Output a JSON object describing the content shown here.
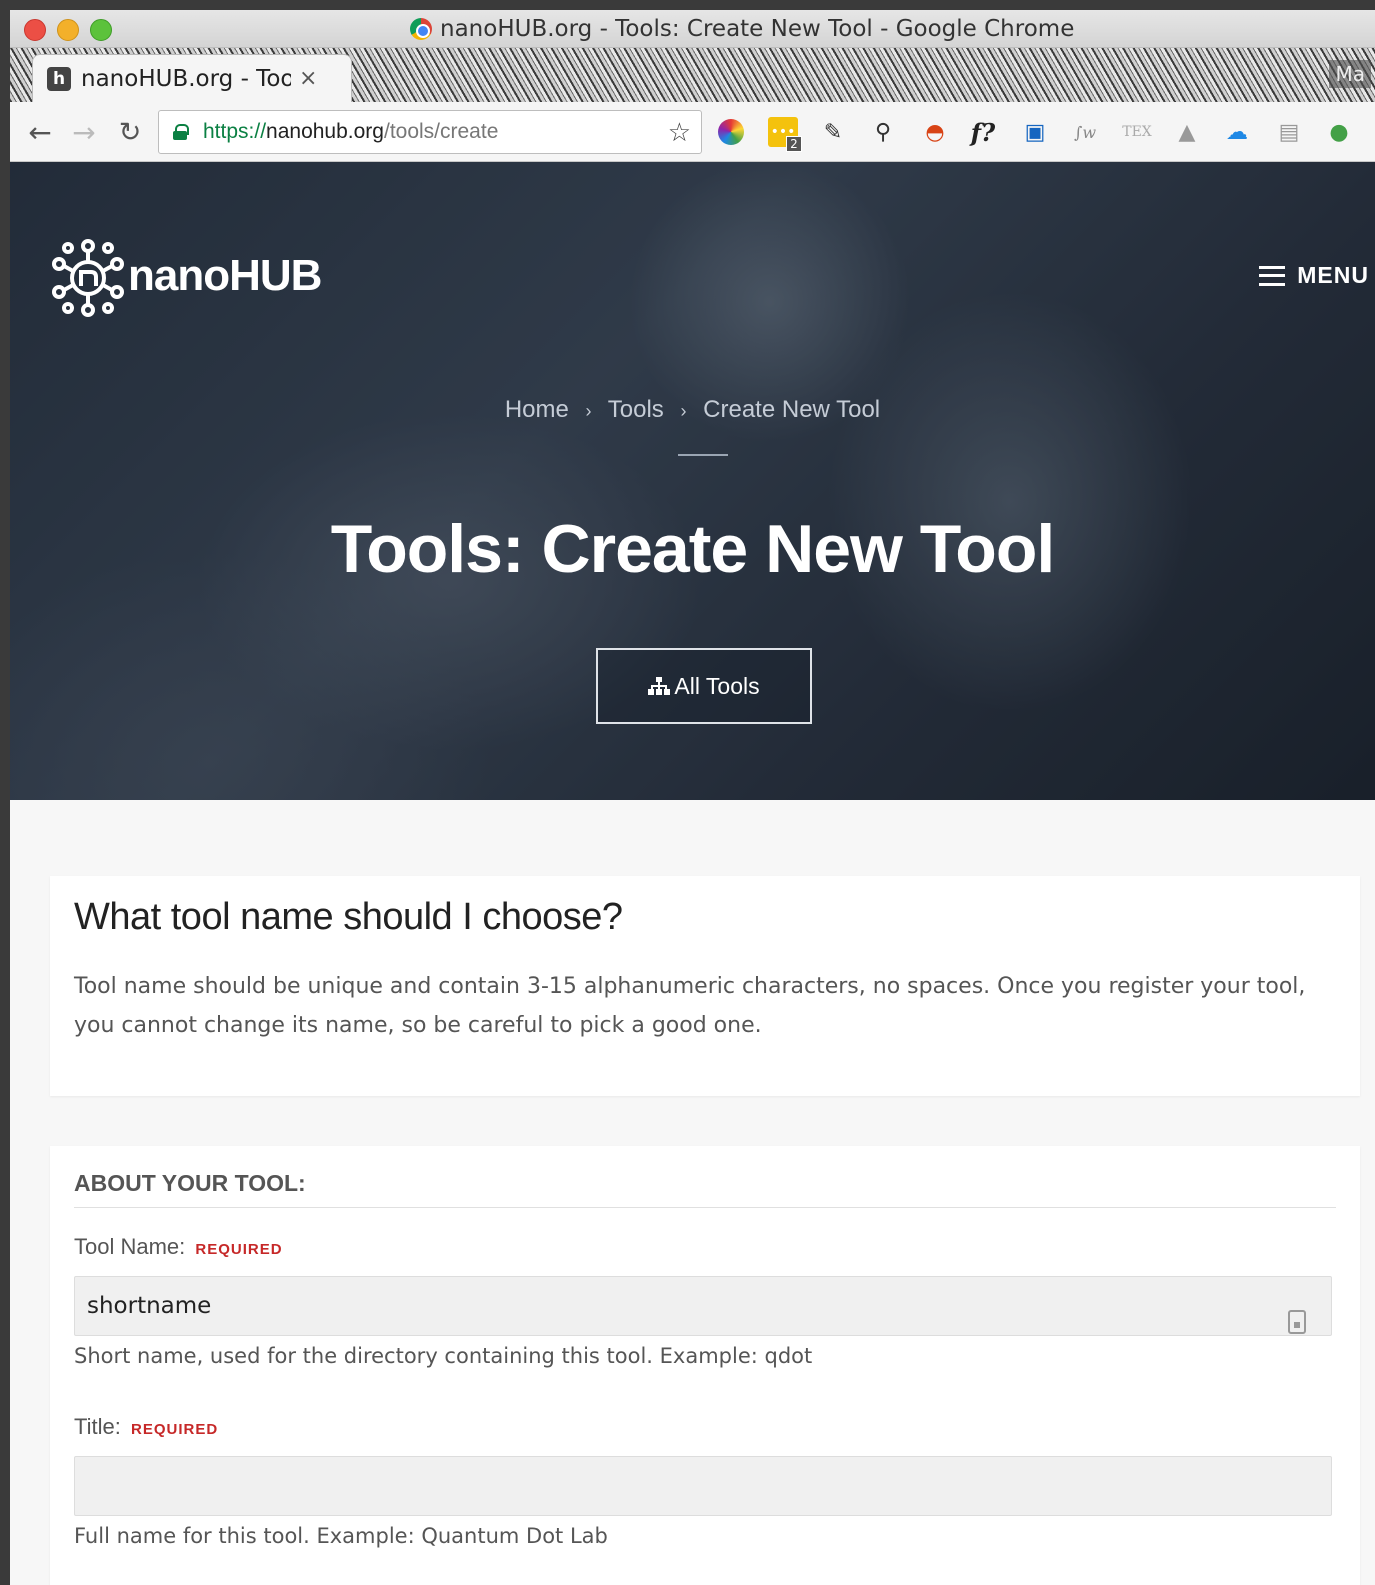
{
  "window": {
    "title": "nanoHUB.org - Tools: Create New Tool - Google Chrome"
  },
  "tab": {
    "title": "nanoHUB.org - Tools: Create New Tool",
    "favicon_letter": "h",
    "close_glyph": "×"
  },
  "profile": {
    "label": "Ma"
  },
  "address_bar": {
    "scheme": "https://",
    "host": "nanohub.org",
    "path": "/tools/create"
  },
  "extensions": [
    "color-picker-icon",
    "notes-icon",
    "evernote-icon",
    "pin-icon",
    "rainbow-icon",
    "fx-icon",
    "image-icon",
    "fw-icon",
    "tex-icon",
    "drive-icon",
    "cloud-icon",
    "doc-icon",
    "leaf-icon"
  ],
  "extension_badge": "2",
  "extension_fx_label": "f?",
  "extension_fw_label": "∫w",
  "extension_tex_label": "TEX",
  "site": {
    "logo_text": "nanoHUB",
    "menu_label": "MENU"
  },
  "breadcrumb": {
    "items": [
      "Home",
      "Tools",
      "Create New Tool"
    ],
    "separator": "›"
  },
  "hero": {
    "title": "Tools: Create New Tool",
    "all_tools_label": "All Tools"
  },
  "help": {
    "title": "What tool name should I choose?",
    "text": "Tool name should be unique and contain 3-15 alphanumeric characters, no spaces. Once you register your tool, you cannot change its name, so be careful to pick a good one."
  },
  "form": {
    "section_title": "ABOUT YOUR TOOL:",
    "tool_name": {
      "label": "Tool Name:",
      "required": "REQUIRED",
      "value": "shortname",
      "help": "Short name, used for the directory containing this tool. Example: qdot"
    },
    "title": {
      "label": "Title:",
      "required": "REQUIRED",
      "value": "",
      "help": "Full name for this tool. Example: Quantum Dot Lab"
    }
  },
  "colors": {
    "hero_overlay": "#2a3442",
    "required_red": "#c62828",
    "secure_green": "#0b8043"
  }
}
